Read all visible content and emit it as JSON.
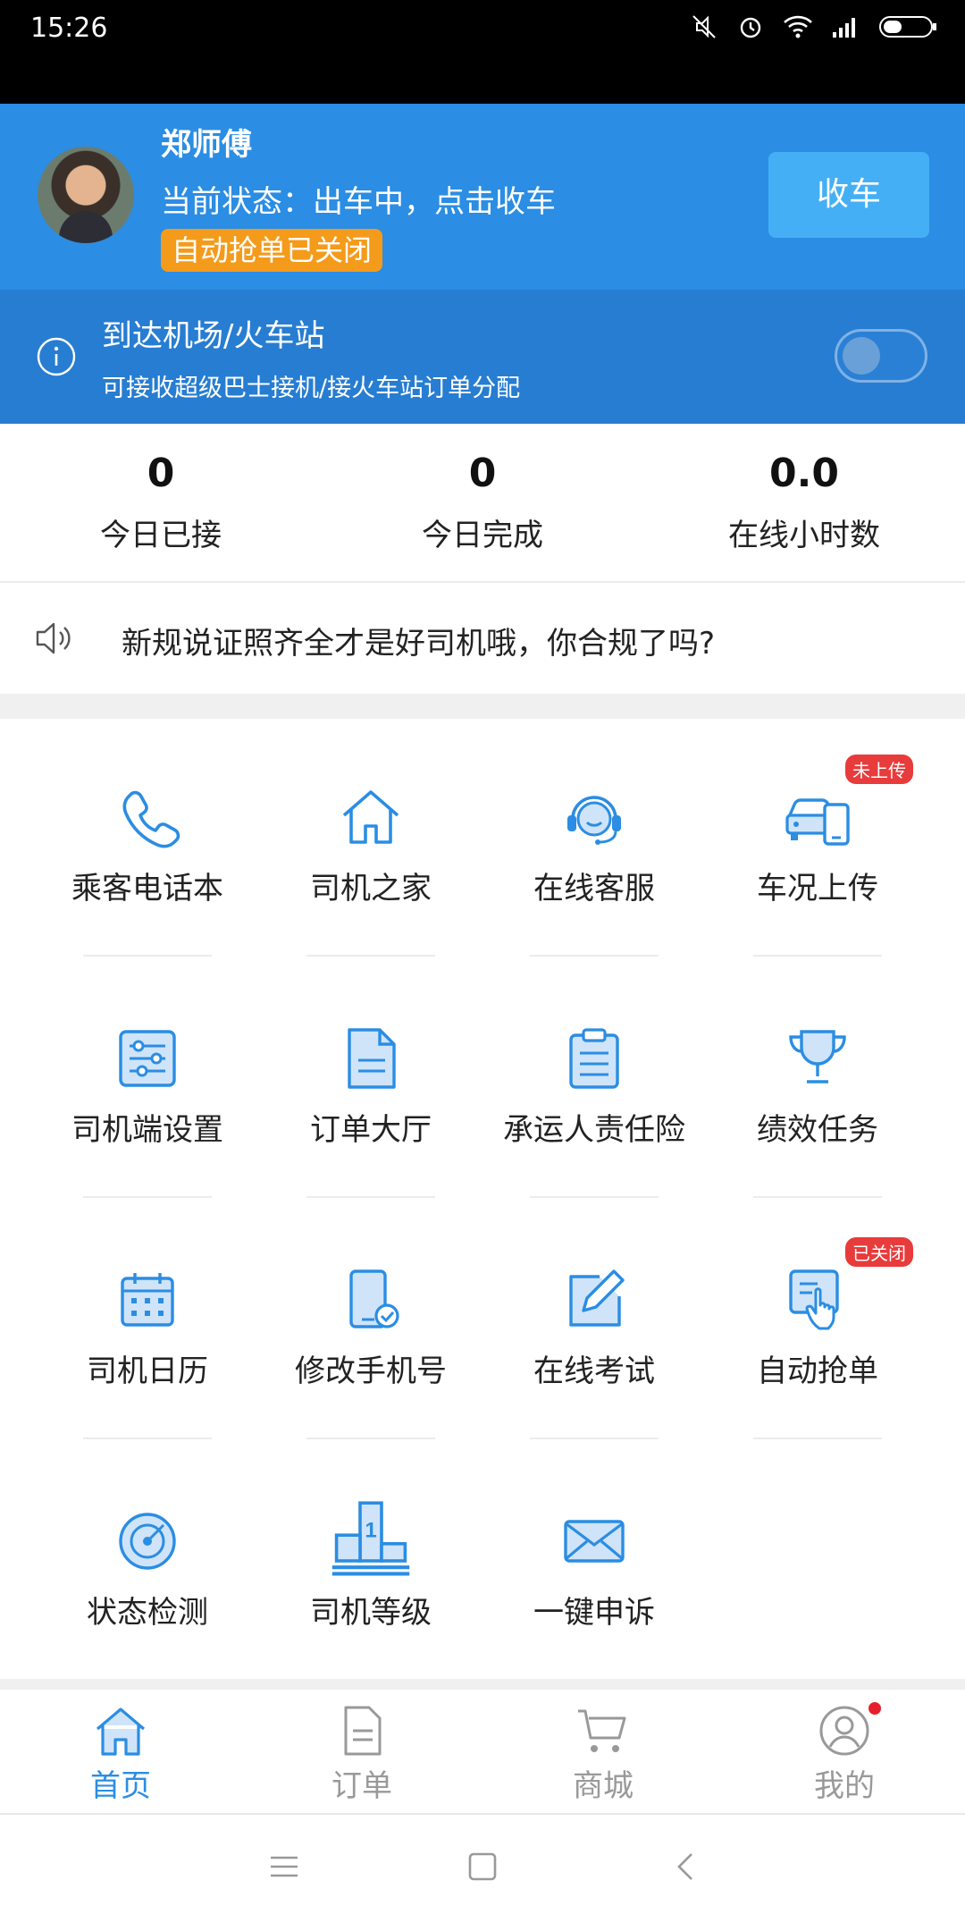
{
  "status_bar": {
    "time": "15:26"
  },
  "driver": {
    "name": "郑师傅",
    "status_text": "当前状态：出车中，点击收车",
    "auto_badge": "自动抢单已关闭",
    "end_shift_button": "收车"
  },
  "airport": {
    "title": "到达机场/火车站",
    "subtitle": "可接收超级巴士接机/接火车站订单分配",
    "toggle_on": false
  },
  "stats": [
    {
      "value": "0",
      "label": "今日已接"
    },
    {
      "value": "0",
      "label": "今日完成"
    },
    {
      "value": "0.0",
      "label": "在线小时数"
    }
  ],
  "notice": {
    "text": "新规说证照齐全才是好司机哦，你合规了吗?"
  },
  "grid": [
    {
      "label": "乘客电话本",
      "icon": "phone-icon"
    },
    {
      "label": "司机之家",
      "icon": "home-icon"
    },
    {
      "label": "在线客服",
      "icon": "headset-icon"
    },
    {
      "label": "车况上传",
      "icon": "car-phone-icon",
      "tag": "未上传"
    },
    {
      "label": "司机端设置",
      "icon": "sliders-icon"
    },
    {
      "label": "订单大厅",
      "icon": "document-icon"
    },
    {
      "label": "承运人责任险",
      "icon": "clipboard-icon"
    },
    {
      "label": "绩效任务",
      "icon": "trophy-icon"
    },
    {
      "label": "司机日历",
      "icon": "calendar-icon"
    },
    {
      "label": "修改手机号",
      "icon": "phone-check-icon"
    },
    {
      "label": "在线考试",
      "icon": "edit-icon"
    },
    {
      "label": "自动抢单",
      "icon": "hand-tap-icon",
      "tag": "已关闭"
    },
    {
      "label": "状态检测",
      "icon": "radar-icon"
    },
    {
      "label": "司机等级",
      "icon": "podium-icon",
      "icon_text": "1"
    },
    {
      "label": "一键申诉",
      "icon": "envelope-icon"
    }
  ],
  "bottom_nav": [
    {
      "label": "首页",
      "icon": "home-icon",
      "active": true
    },
    {
      "label": "订单",
      "icon": "document-icon"
    },
    {
      "label": "商城",
      "icon": "cart-icon"
    },
    {
      "label": "我的",
      "icon": "user-icon",
      "badge_dot": true
    }
  ],
  "colors": {
    "primary": "#2b8de3",
    "strip": "#277dd1",
    "badge_orange": "#f49b1b",
    "tag_red": "#e83b3b"
  }
}
